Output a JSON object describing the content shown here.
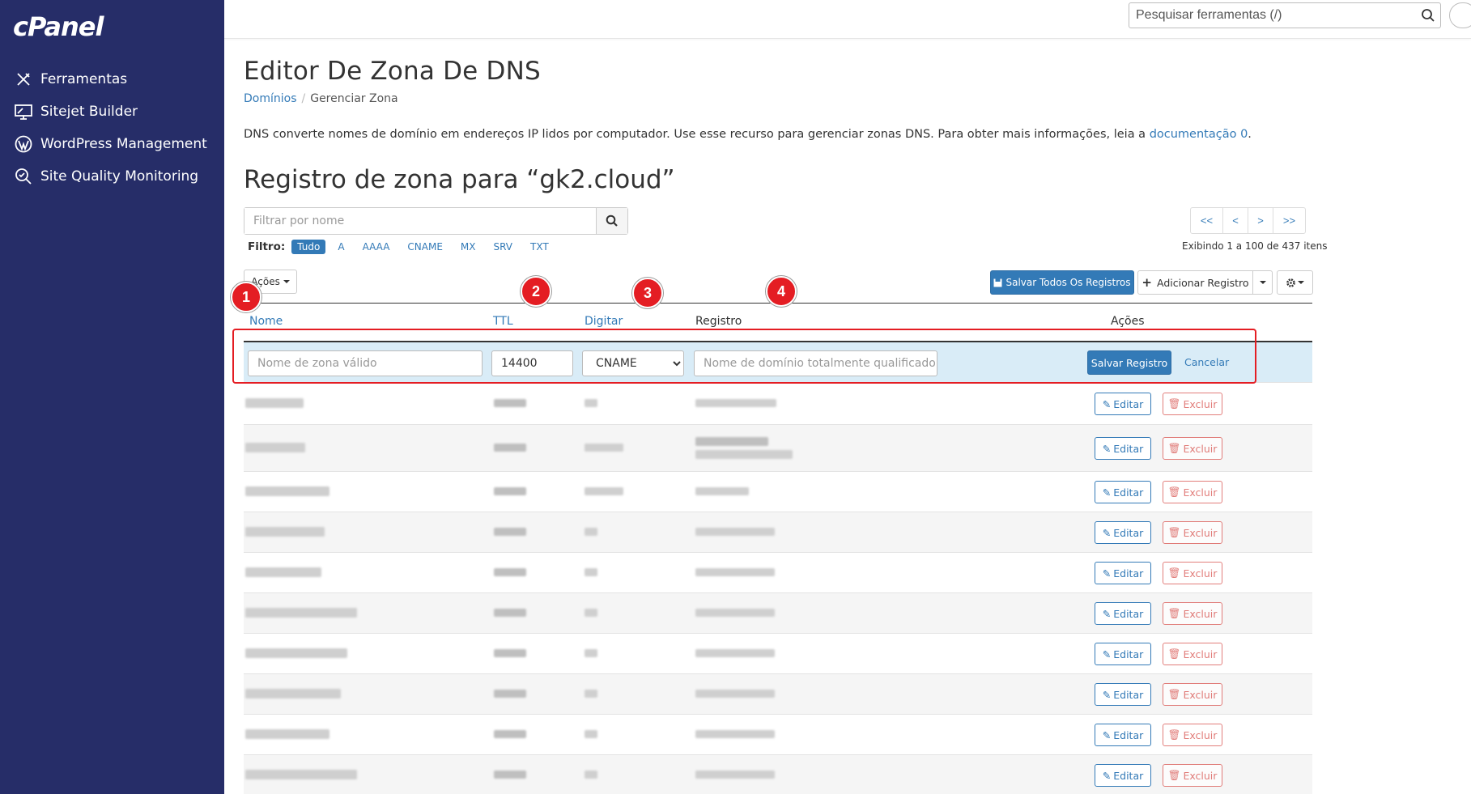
{
  "app": {
    "logo": "cPanel"
  },
  "sidebar": {
    "items": [
      {
        "label": "Ferramentas",
        "icon": "tools-icon"
      },
      {
        "label": "Sitejet Builder",
        "icon": "monitor-icon"
      },
      {
        "label": "WordPress Management",
        "icon": "wordpress-icon"
      },
      {
        "label": "Site Quality Monitoring",
        "icon": "magnifier-icon"
      }
    ]
  },
  "topbar": {
    "search_placeholder": "Pesquisar ferramentas (/)"
  },
  "page": {
    "title": "Editor De Zona De DNS",
    "breadcrumb": {
      "parent": "Domínios",
      "current": "Gerenciar Zona"
    },
    "description": "DNS converte nomes de domínio em endereços IP lidos por computador. Use esse recurso para gerenciar zonas DNS. Para obter mais informações, leia a ",
    "description_link": "documentação 0",
    "zone_title": "Registro de zona para “gk2.cloud”"
  },
  "filter": {
    "placeholder": "Filtrar por nome",
    "label": "Filtro:",
    "options": [
      "Tudo",
      "A",
      "AAAA",
      "CNAME",
      "MX",
      "SRV",
      "TXT"
    ],
    "active": "Tudo"
  },
  "pager": {
    "first": "<<",
    "prev": "<",
    "next": ">",
    "last": ">>",
    "showing": "Exibindo 1 a 100 de 437 itens"
  },
  "toolbar": {
    "acoes": "Ações",
    "save_all": "Salvar Todos Os Registros",
    "add_record": "Adicionar Registro"
  },
  "table": {
    "headers": {
      "nome": "Nome",
      "ttl": "TTL",
      "tipo": "Digitar",
      "registro": "Registro",
      "acoes": "Ações"
    },
    "badges": [
      "1",
      "2",
      "3",
      "4"
    ],
    "edit_row": {
      "name_placeholder": "Nome de zona válido",
      "ttl_value": "14400",
      "type_value": "CNAME",
      "record_placeholder": "Nome de domínio totalmente qualificado",
      "save": "Salvar Registro",
      "cancel": "Cancelar"
    },
    "row_actions": {
      "edit": "Editar",
      "delete": "Excluir"
    },
    "rows_count": 10
  },
  "colors": {
    "sidebar": "#262d68",
    "primary": "#337ab7",
    "danger": "#d9534f",
    "highlight": "#e41d23",
    "edit_row_bg": "#d9ecf7"
  }
}
